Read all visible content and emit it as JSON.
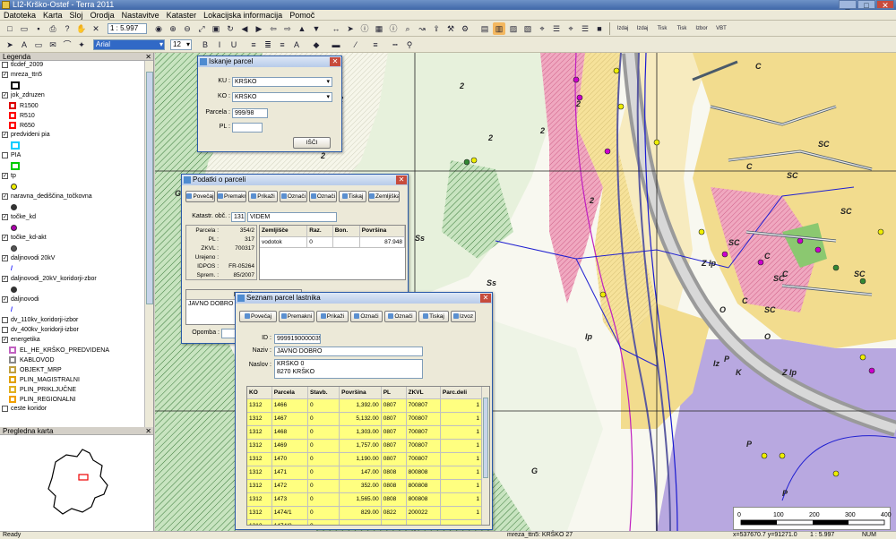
{
  "window": {
    "title": "LI2-Krško-Ostef - Terra 2011"
  },
  "menu": [
    "Datoteka",
    "Karta",
    "Sloj",
    "Orodja",
    "Nastavitve",
    "Kataster",
    "Lokacijska informacija",
    "Pomoč"
  ],
  "toolbar": {
    "zoom": "1 : 5.997",
    "font": "Arial",
    "font_size": "12",
    "labels": [
      "Izdaj",
      "Izdaj",
      "Tisk",
      "Tisk",
      "Izbor",
      "VBT"
    ]
  },
  "legend": {
    "title": "Legenda",
    "layers": [
      {
        "label": "tlcdef_2009",
        "checked": false
      },
      {
        "label": "mreza_ttn5",
        "checked": true
      },
      {
        "label": "jok_zdruzen",
        "checked": true,
        "children": [
          "R1500",
          "R510",
          "R650"
        ]
      },
      {
        "label": "predvideni pia",
        "checked": true
      },
      {
        "label": "PIA",
        "checked": false
      },
      {
        "label": "tp",
        "checked": true
      },
      {
        "label": "naravna_dediščina_točkovna",
        "checked": true
      },
      {
        "label": "točke_kd",
        "checked": true
      },
      {
        "label": "točke_kd-akt",
        "checked": true
      },
      {
        "label": "daljnovodi 20kV",
        "checked": true
      },
      {
        "label": "daljnovodi_20kV_koridorji-zbor",
        "checked": true
      },
      {
        "label": "daljnovodi",
        "checked": true
      },
      {
        "label": "dv_110kv_koridorji-izbor",
        "checked": false
      },
      {
        "label": "dv_400kv_koridorji-izbor",
        "checked": false
      },
      {
        "label": "energetika",
        "checked": true,
        "children": [
          "EL_HE_KRŠKO_PREDVIDENA",
          "KABLOVOD",
          "OBJEKT_MRP",
          "PLIN_MAGISTRALNI",
          "PLIN_PRIKLJUČNE",
          "PLIN_REGIONALNI"
        ]
      },
      {
        "label": "ceste koridor",
        "checked": false
      }
    ]
  },
  "overview": {
    "title": "Pregledna karta"
  },
  "status": {
    "left": "Ready",
    "layer": "mreza_ttn5: KRŠKO 27",
    "coords": "x=537670.7  y=91271.0",
    "scale": "1 : 5.997",
    "mode": "NUM"
  },
  "scalebar": {
    "labels": [
      "0",
      "100",
      "200",
      "300",
      "400m"
    ]
  },
  "map_labels": [
    "2",
    "2",
    "2",
    "2",
    "2",
    "2",
    "2",
    "2",
    "SC",
    "SC",
    "SC",
    "SC",
    "SC",
    "SC",
    "SC",
    "C",
    "C",
    "C",
    "C",
    "C",
    "O",
    "O",
    "P",
    "P",
    "P",
    "G",
    "G",
    "G",
    "Ss",
    "Ss",
    "Ss",
    "Ss",
    "Ss",
    "Z Ip",
    "Z Ip",
    "Ip",
    "Iz",
    "K"
  ],
  "iskanje": {
    "title": "Iskanje parcel",
    "ku_label": "KU :",
    "ku_value": "KRŠKO",
    "ko_label": "KO :",
    "ko_value": "KRŠKO",
    "parcela_label": "Parcela :",
    "parcela_value": "999/98",
    "pl_label": "PL :",
    "pl_value": "",
    "button": "IŠČI"
  },
  "podatki": {
    "title": "Podatki o parceli",
    "buttons": [
      "Povečaj",
      "Premakni",
      "Prikaži",
      "Označi",
      "Označi",
      "Tiskaj",
      "Zemljiška knjiga"
    ],
    "katastr_label": "Katastr. obč. :",
    "katastr_code": "1315",
    "katastr_name": "VIDEM",
    "fields": [
      {
        "label": "Parcela :",
        "value": "354/2"
      },
      {
        "label": "PL :",
        "value": "317"
      },
      {
        "label": "ZKVL :",
        "value": "700317"
      },
      {
        "label": "Urejeno :",
        "value": ""
      },
      {
        "label": "IDPOS :",
        "value": "FR-05264"
      },
      {
        "label": "Sprem. :",
        "value": "85/2007"
      }
    ],
    "zemljisce": {
      "headers": [
        "Zemljišče",
        "Raz.",
        "Bon.",
        "Površina"
      ],
      "rows": [
        [
          "vodotok",
          "0",
          "",
          "87.948"
        ]
      ]
    },
    "lastnik_header": "Lastnik",
    "lastnik_value": "JAVNO DOBRO",
    "opomba_label": "Opomba :"
  },
  "seznam": {
    "title": "Seznam parcel lastnika",
    "buttons": [
      "Povečaj",
      "Premakni",
      "Prikaži",
      "Označi",
      "Označi",
      "Tiskaj",
      "Izvoz"
    ],
    "id_label": "ID :",
    "id_value": "9999190000035",
    "naziv_label": "Naziv :",
    "naziv_value": "JAVNO DOBRO",
    "naslov_label": "Naslov :",
    "naslov_line1": "KRŠKO 0",
    "naslov_line2": "8270 KRŠKO",
    "headers": [
      "KO",
      "Parcela",
      "Stavb.",
      "Površina",
      "PL",
      "ZKVL",
      "Parc.deli"
    ],
    "rows": [
      [
        "1312",
        "1466",
        "0",
        "1,392.00",
        "0807",
        "700807",
        "1"
      ],
      [
        "1312",
        "1467",
        "0",
        "5,132.00",
        "0807",
        "700807",
        "1"
      ],
      [
        "1312",
        "1468",
        "0",
        "1,303.00",
        "0807",
        "700807",
        "1"
      ],
      [
        "1312",
        "1469",
        "0",
        "1,757.00",
        "0807",
        "700807",
        "1"
      ],
      [
        "1312",
        "1470",
        "0",
        "1,190.00",
        "0807",
        "700807",
        "1"
      ],
      [
        "1312",
        "1471",
        "0",
        "147.00",
        "0808",
        "800808",
        "1"
      ],
      [
        "1312",
        "1472",
        "0",
        "352.00",
        "0808",
        "800808",
        "1"
      ],
      [
        "1312",
        "1473",
        "0",
        "1,565.00",
        "0808",
        "800808",
        "1"
      ],
      [
        "1312",
        "1474/1",
        "0",
        "829.00",
        "0822",
        "200022",
        "1"
      ],
      [
        "1312",
        "1474/2",
        "0",
        "",
        "",
        "",
        ""
      ]
    ]
  }
}
